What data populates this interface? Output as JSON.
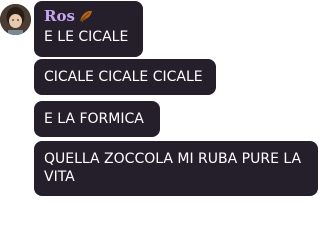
{
  "sender": {
    "name": "Ros",
    "emoji_icon": "leaf-emoji-icon"
  },
  "messages": [
    {
      "text": "E LE CICALE"
    },
    {
      "text": "CICALE CICALE CICALE"
    },
    {
      "text": "E LA FORMICA"
    },
    {
      "text": "QUELLA ZOCCOLA MI RUBA PURE LA VITA"
    }
  ],
  "colors": {
    "bubble": "#241f2b",
    "sender_name": "#c7a6f0",
    "text": "#ffffff"
  }
}
